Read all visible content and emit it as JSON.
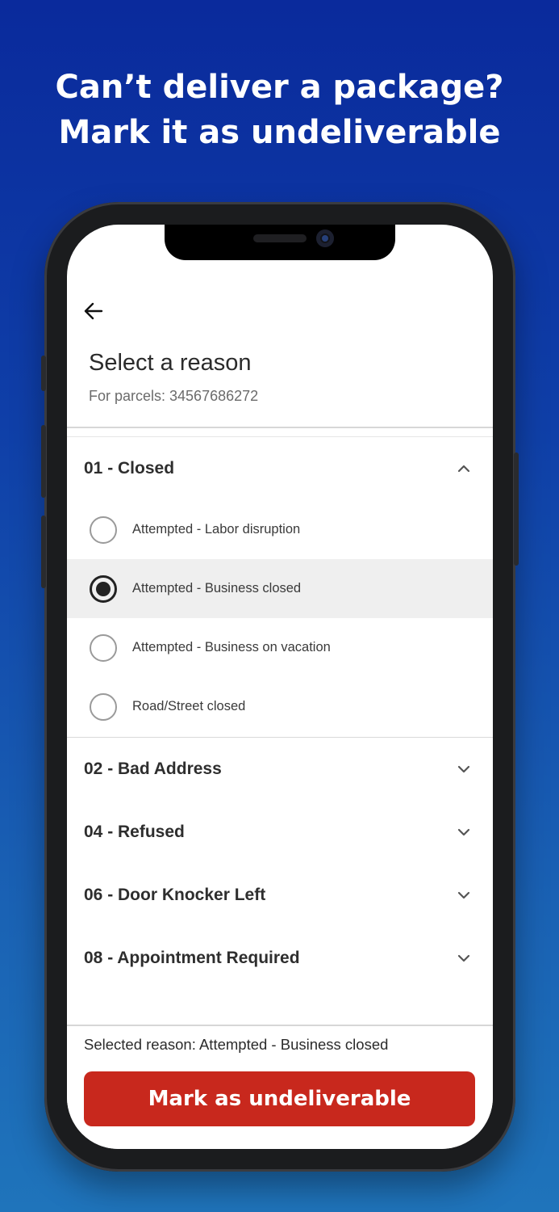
{
  "promo": {
    "line1": "Can’t deliver a package?",
    "line2": "Mark it as undeliverable"
  },
  "header": {
    "title": "Select a reason",
    "subtitle": "For parcels: 34567686272"
  },
  "groups": [
    {
      "label": "01 - Closed",
      "expanded": true,
      "options": [
        {
          "label": "Attempted - Labor disruption",
          "selected": false
        },
        {
          "label": "Attempted - Business closed",
          "selected": true
        },
        {
          "label": "Attempted - Business on vacation",
          "selected": false
        },
        {
          "label": "Road/Street closed",
          "selected": false
        }
      ]
    },
    {
      "label": "02 - Bad Address",
      "expanded": false
    },
    {
      "label": "04 - Refused",
      "expanded": false
    },
    {
      "label": "06 - Door Knocker Left",
      "expanded": false
    },
    {
      "label": "08 - Appointment Required",
      "expanded": false
    }
  ],
  "footer": {
    "selected_reason": "Selected reason: Attempted - Business closed",
    "button_label": "Mark as undeliverable"
  },
  "colors": {
    "accent": "#c8281d",
    "background_top": "#0a2a9c",
    "background_bottom": "#1f74bb"
  }
}
